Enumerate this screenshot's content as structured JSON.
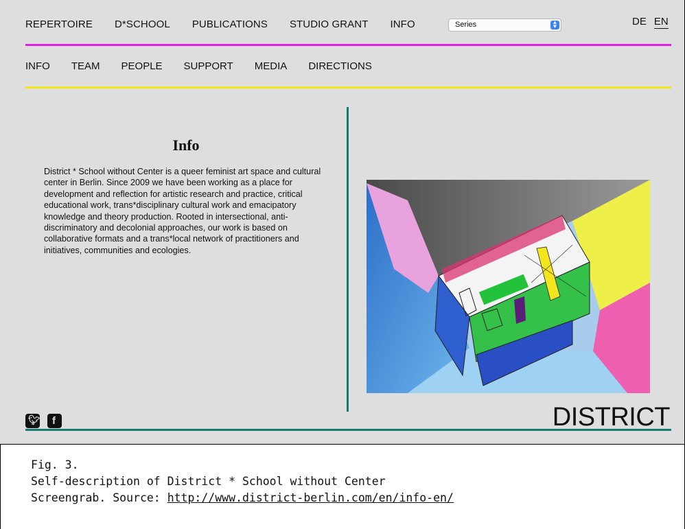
{
  "topnav": {
    "items": [
      "REPERTOIRE",
      "D*SCHOOL",
      "PUBLICATIONS",
      "STUDIO GRANT",
      "INFO"
    ],
    "select_value": "Series",
    "lang": [
      "DE",
      "EN"
    ],
    "active_lang": "EN"
  },
  "subnav": {
    "items": [
      "INFO",
      "TEAM",
      "PEOPLE",
      "SUPPORT",
      "MEDIA",
      "DIRECTIONS"
    ]
  },
  "main": {
    "title": "Info",
    "body": "District * School without Center is a queer feminist art space and cultural center in Berlin. Since 2009 we have been working as a place for development and reflection for artistic research and practice, critical educational work, trans*disciplinary cultural work and emacipatory knowledge and theory production. Rooted in intersectional, anti-discriminatory and decolonial approaches, our work is based on collaborative formats and a trans*local network of practitioners and initiatives, communities and ecologies."
  },
  "footer": {
    "social_icons": [
      "twitter-icon",
      "facebook-icon"
    ],
    "logo": "DISTRICT"
  },
  "caption": {
    "line1": "Fig. 3.",
    "line2": "Self-description of District * School without Center",
    "line3_prefix": "Screengrab. Source: ",
    "url": "http://www.district-berlin.com/en/info-en/"
  },
  "colors": {
    "magenta_line": "#e020e6",
    "yellow_line": "#f2e51a",
    "teal_line": "#127b73",
    "background": "#dedede"
  }
}
